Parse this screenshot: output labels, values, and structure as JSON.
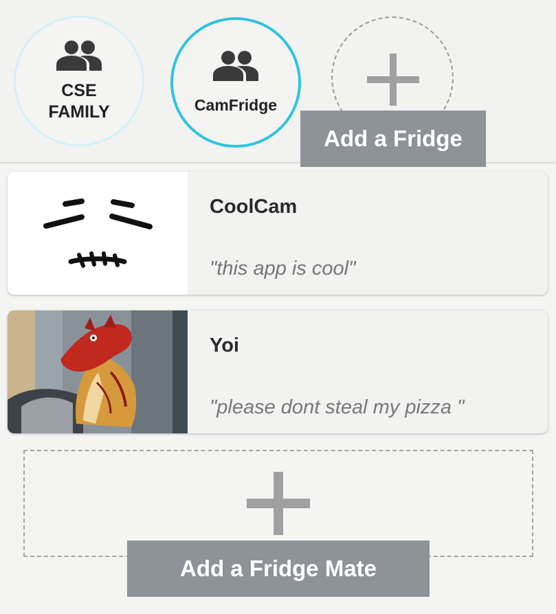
{
  "fridges": [
    {
      "name": "CSE FAMILY",
      "icon": "people-icon",
      "selected": false
    },
    {
      "name": "CamFridge",
      "icon": "people-icon",
      "selected": true
    }
  ],
  "add_fridge": {
    "label": "Add a Fridge",
    "icon": "plus-icon"
  },
  "mates": [
    {
      "name": "CoolCam",
      "status": "\"this app is cool\"",
      "avatar": "squint-face-drawing"
    },
    {
      "name": "Yoi",
      "status": "\"please dont steal my pizza \"",
      "avatar": "red-dragon-puppet-photo"
    }
  ],
  "add_mate": {
    "label": "Add a Fridge Mate",
    "icon": "plus-icon"
  },
  "colors": {
    "accent": "#2ec4df",
    "accent_light": "#d3f0f6",
    "tag_bg": "#8d9396",
    "plus": "#a0a0a0"
  }
}
